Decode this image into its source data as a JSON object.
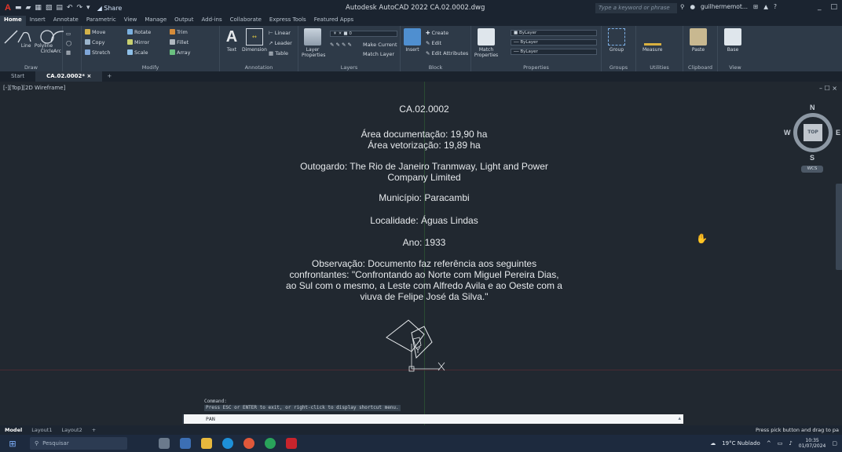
{
  "titlebar": {
    "app_logo": "A",
    "share": "Share",
    "title": "Autodesk AutoCAD 2022   CA.02.0002.dwg",
    "search_placeholder": "Type a keyword or phrase",
    "user": "guilhermemot...",
    "minimize": "_",
    "restore": "□"
  },
  "ribbon_tabs": [
    "Home",
    "Insert",
    "Annotate",
    "Parametric",
    "View",
    "Manage",
    "Output",
    "Add-ins",
    "Collaborate",
    "Express Tools",
    "Featured Apps"
  ],
  "ribbon": {
    "draw": {
      "title": "Draw",
      "tools": [
        "Line",
        "Polyline",
        "Circle",
        "Arc"
      ]
    },
    "modify": {
      "title": "Modify",
      "move": "Move",
      "rotate": "Rotate",
      "trim": "Trim",
      "copy": "Copy",
      "mirror": "Mirror",
      "fillet": "Fillet",
      "stretch": "Stretch",
      "scale": "Scale",
      "array": "Array"
    },
    "annotation": {
      "title": "Annotation",
      "text": "Text",
      "dimension": "Dimension",
      "linear": "Linear",
      "leader": "Leader",
      "table": "Table"
    },
    "layers": {
      "title": "Layers",
      "layer_properties": "Layer Properties",
      "current_layer": "0",
      "make_current": "Make Current",
      "match_layer": "Match Layer"
    },
    "block": {
      "title": "Block",
      "insert": "Insert",
      "create": "Create",
      "edit": "Edit",
      "edit_attributes": "Edit Attributes"
    },
    "properties": {
      "title": "Properties",
      "match": "Match Properties",
      "bylayer1": "ByLayer",
      "bylayer2": "ByLayer",
      "bylayer3": "ByLayer"
    },
    "groups": {
      "title": "Groups",
      "group": "Group"
    },
    "utilities": {
      "title": "Utilities",
      "measure": "Measure"
    },
    "clipboard": {
      "title": "Clipboard",
      "paste": "Paste"
    },
    "view": {
      "title": "View",
      "base": "Base"
    }
  },
  "doc_tabs": {
    "start": "Start",
    "active": "CA.02.0002*",
    "close": "×",
    "plus": "+"
  },
  "viewport": {
    "label": "[-][Top][2D Wireframe]",
    "controls": "– ☐ ×",
    "viewcube": {
      "n": "N",
      "s": "S",
      "e": "E",
      "w": "W",
      "top": "TOP",
      "wcs": "WCS"
    }
  },
  "drawing_text": {
    "code": "CA.02.0002",
    "area_doc": "Área documentação: 19,90 ha",
    "area_vet": "Área vetorização: 19,89 ha",
    "outorgado1": "Outogardo:  The Rio de Janeiro Tranmway, Light and Power",
    "outorgado2": "Company Limited",
    "municipio": "Município: Paracambi",
    "localidade": "Localidade: Águas Lindas",
    "ano": "Ano: 1933",
    "obs1": "Observação: Documento faz referência aos seguintes",
    "obs2": "confrontantes: \"Confrontando ao Norte com Miguel Pereira Dias,",
    "obs3": "ao Sul com o mesmo, a Leste com Alfredo Avila e ao Oeste com a",
    "obs4": "viuva de Felipe José da Silva.\""
  },
  "command": {
    "history1": "Command:",
    "history2": "Press ESC or ENTER to exit, or right-click to display shortcut menu.",
    "prompt": "PAN"
  },
  "layout_tabs": [
    "Model",
    "Layout1",
    "Layout2",
    "+"
  ],
  "status_message": "Press pick button and drag to pa",
  "taskbar": {
    "search": "Pesquisar",
    "weather": "19°C  Nublado",
    "time": "10:35",
    "date": "01/07/2024"
  }
}
